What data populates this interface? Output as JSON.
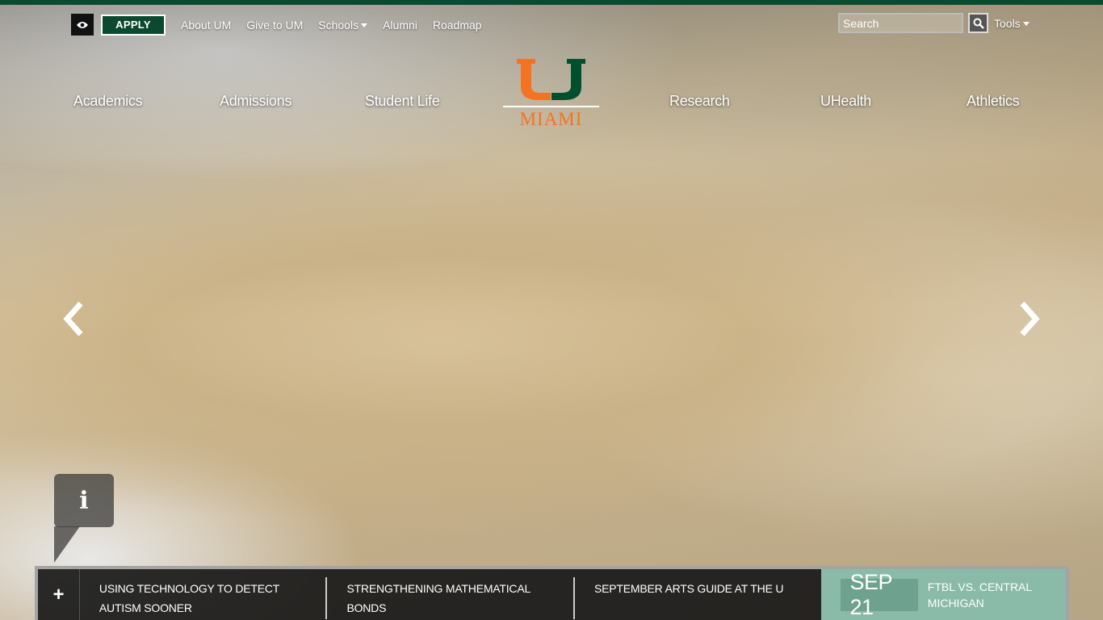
{
  "utility": {
    "apply_label": "APPLY",
    "links": [
      {
        "label": "About UM",
        "dropdown": false
      },
      {
        "label": "Give to UM",
        "dropdown": false
      },
      {
        "label": "Schools",
        "dropdown": true
      },
      {
        "label": "Alumni",
        "dropdown": false
      },
      {
        "label": "Roadmap",
        "dropdown": false
      }
    ],
    "search_placeholder": "Search",
    "tools_label": "Tools"
  },
  "main_nav": [
    "Academics",
    "Admissions",
    "Student Life",
    "Research",
    "UHealth",
    "Athletics"
  ],
  "logo": {
    "text": "MIAMI",
    "colors": {
      "orange": "#f47321",
      "green": "#005030"
    }
  },
  "carousel": {
    "prev_icon": "chevron-left-icon",
    "next_icon": "chevron-right-icon",
    "info_label": "i"
  },
  "news_bar": {
    "expand_label": "+",
    "items": [
      "USING TECHNOLOGY TO DETECT AUTISM SOONER",
      "STRENGTHENING MATHEMATICAL BONDS",
      "SEPTEMBER ARTS GUIDE AT THE U"
    ],
    "event": {
      "date": "SEP 21",
      "title": "FTBL VS. CENTRAL MICHIGAN"
    }
  },
  "colors": {
    "brand_green": "#0b4a30",
    "event_bg": "#8abaa8",
    "event_date_bg": "#6ea28f"
  }
}
